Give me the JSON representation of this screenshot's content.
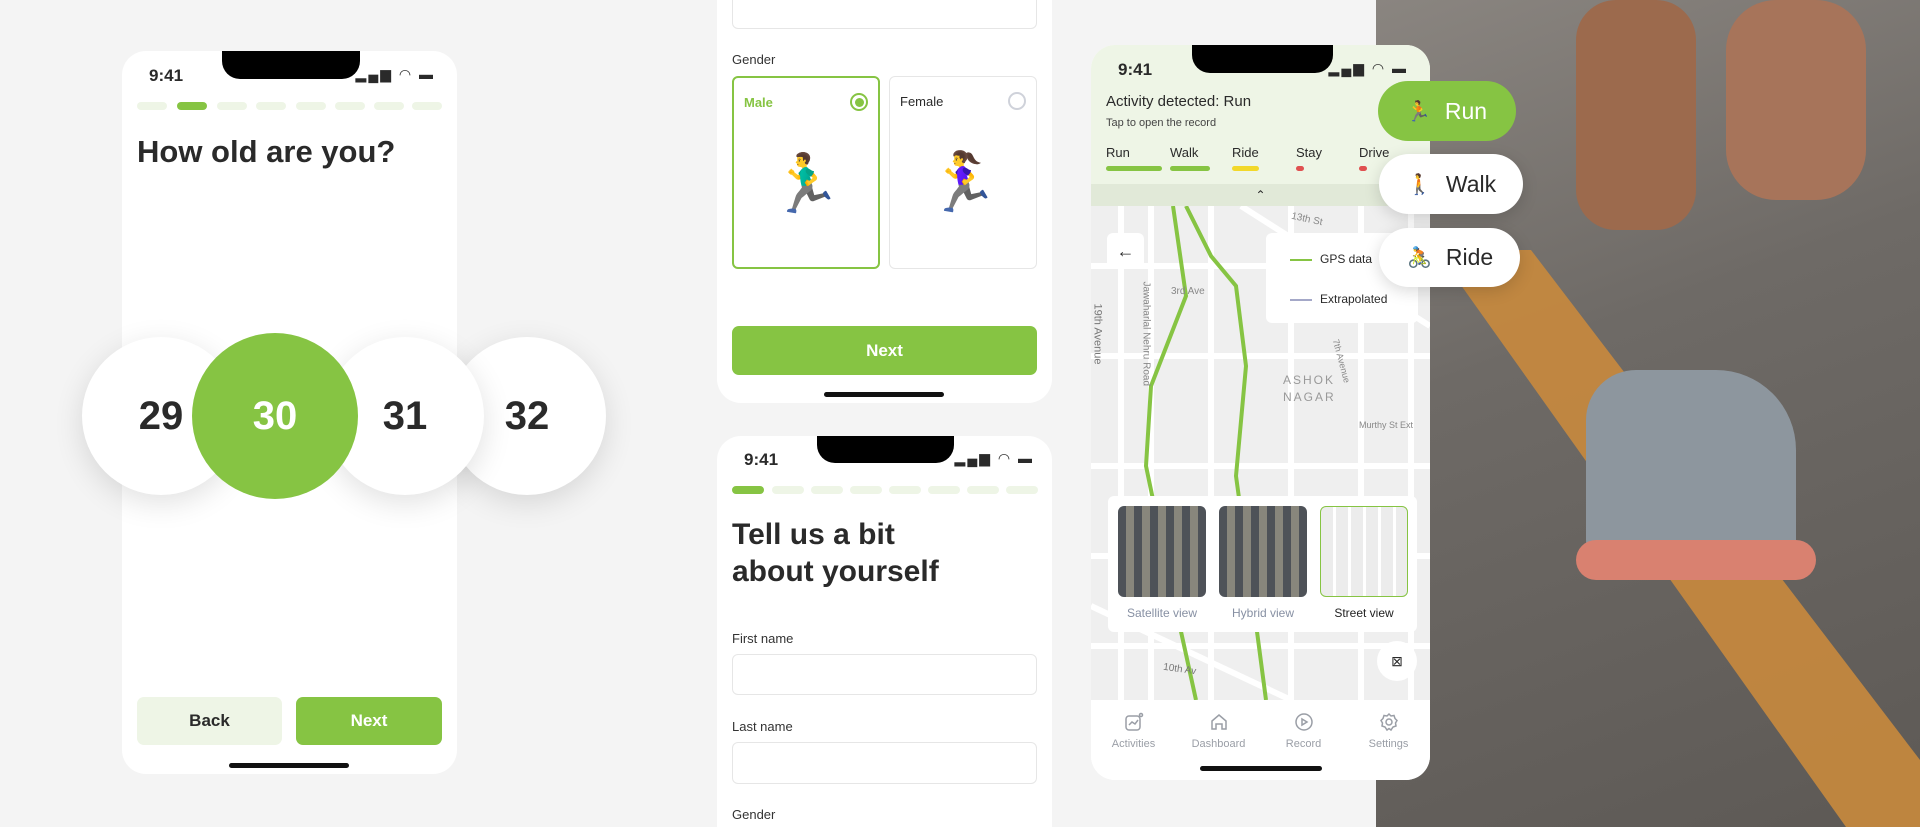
{
  "age_screen": {
    "time": "9:41",
    "title": "How old are you?",
    "ages": [
      "29",
      "30",
      "31",
      "32"
    ],
    "selected": "30",
    "back_label": "Back",
    "next_label": "Next",
    "progress_step": 2,
    "progress_total": 8
  },
  "gender_screen": {
    "gender_label": "Gender",
    "options": [
      {
        "label": "Male",
        "selected": true,
        "emoji": "🏃‍♂️"
      },
      {
        "label": "Female",
        "selected": false,
        "emoji": "🏃‍♀️"
      }
    ],
    "next_label": "Next"
  },
  "about_screen": {
    "time": "9:41",
    "title_line1": "Tell us a bit",
    "title_line2": "about yourself",
    "first_name_label": "First name",
    "first_name_value": "",
    "last_name_label": "Last name",
    "last_name_value": "",
    "gender_label": "Gender",
    "progress_step": 1,
    "progress_total": 8
  },
  "activity_screen": {
    "time": "9:41",
    "headline": "Activity detected: Run",
    "subtitle": "Tap to open the record",
    "activities": [
      {
        "label": "Run",
        "color": "#86c443"
      },
      {
        "label": "Walk",
        "color": "#86c443"
      },
      {
        "label": "Ride",
        "color": "#f2d82a"
      },
      {
        "label": "Stay",
        "color": "#e05050"
      },
      {
        "label": "Drive",
        "color": "#e05050"
      }
    ],
    "legend": {
      "gps": "GPS data",
      "extrapolated": "Extrapolated"
    },
    "streets": [
      "13th St",
      "3rd Ave",
      "19th Avenue",
      "Jawaharlal Nehru Road",
      "7th Avenue",
      "ASHOK",
      "NAGAR",
      "Murthy St Ext",
      "10th Av"
    ],
    "views": [
      {
        "label": "Satellite view",
        "selected": false
      },
      {
        "label": "Hybrid view",
        "selected": false
      },
      {
        "label": "Street view",
        "selected": true
      }
    ],
    "nav": [
      "Activities",
      "Dashboard",
      "Record",
      "Settings"
    ]
  },
  "activity_pills": [
    {
      "label": "Run",
      "emoji": "🏃",
      "active": true
    },
    {
      "label": "Walk",
      "emoji": "🚶",
      "active": false
    },
    {
      "label": "Ride",
      "emoji": "🚴",
      "active": false
    }
  ],
  "colors": {
    "accent": "#86c443",
    "tint": "#eef5e6"
  }
}
